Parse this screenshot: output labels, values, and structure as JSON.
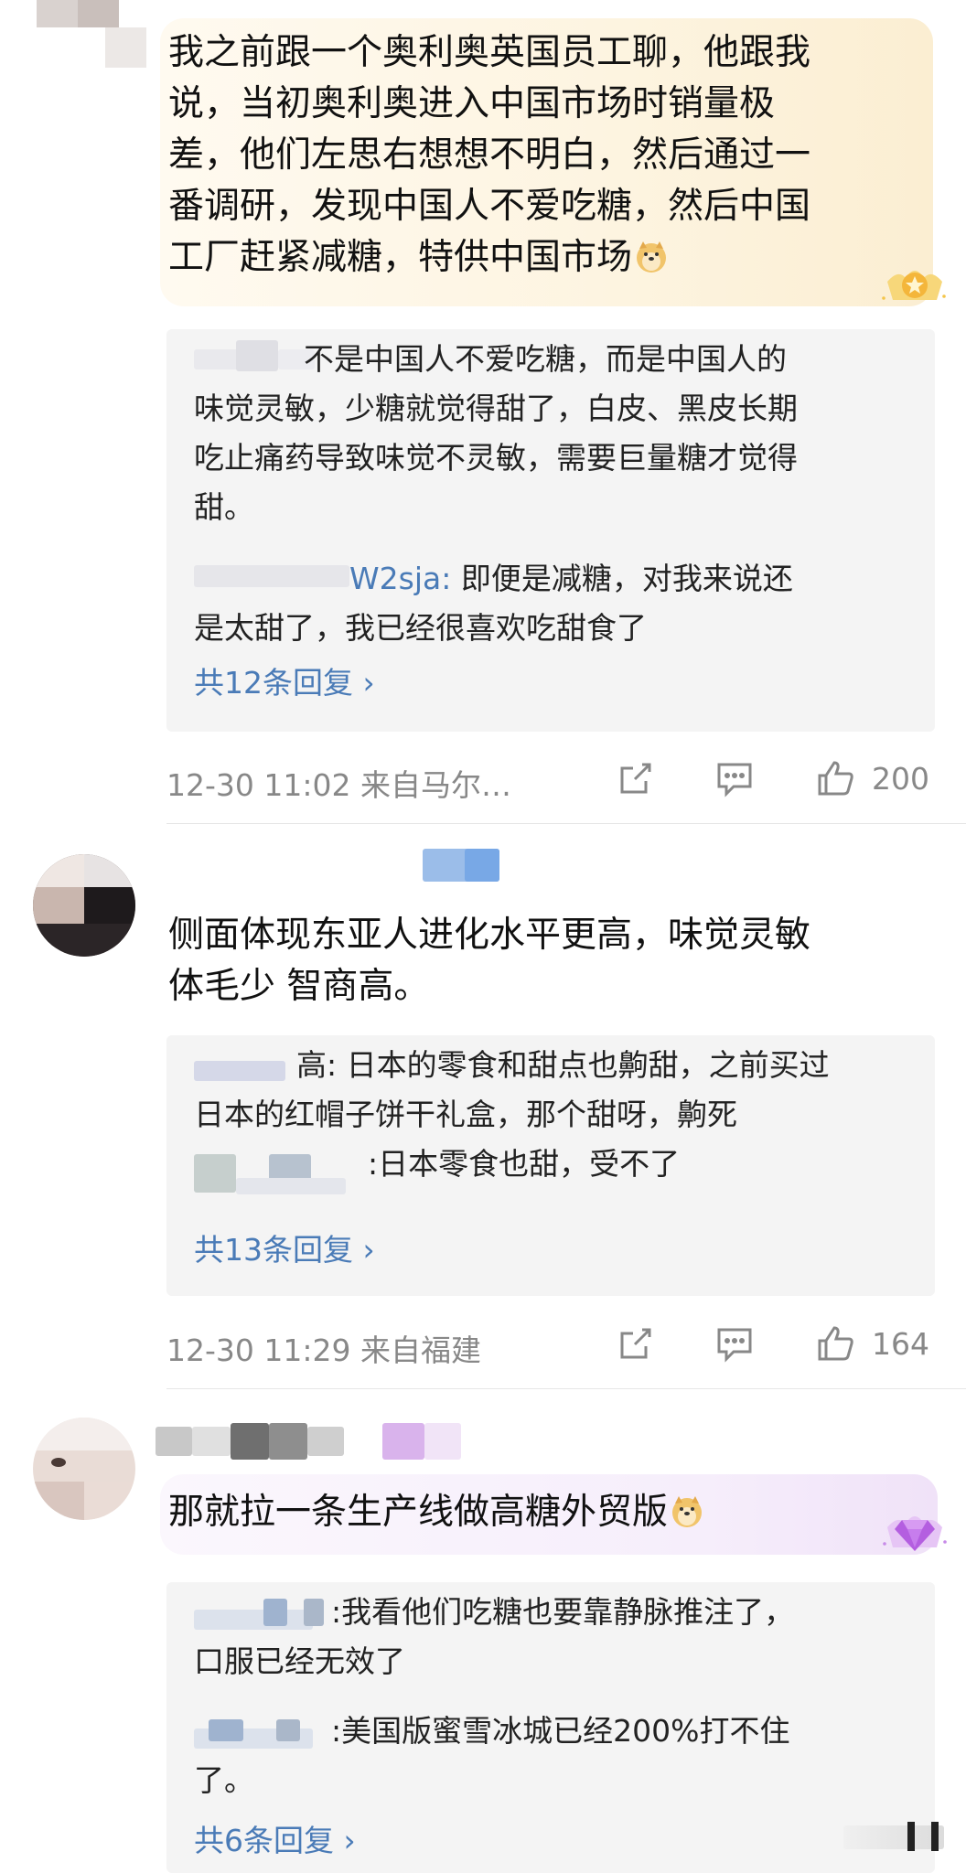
{
  "comments": [
    {
      "text_lines": [
        "我之前跟一个奥利奥英国员工聊，他跟我",
        "说，当初奥利奥进入中国市场时销量极",
        "差，他们左思右想想不明白，然后通过一",
        "番调研，发现中国人不爱吃糖，然后中国",
        "工厂赶紧减糖，特供中国市场"
      ],
      "emoji": "doge-emoji",
      "badge": "crown-star-badge",
      "replies": [
        {
          "lines": [
            "不是中国人不爱吃糖，而是中国人的",
            "味觉灵敏，少糖就觉得甜了，白皮、黑皮长期",
            "吃止痛药导致味觉不灵敏，需要巨量糖才觉得",
            "甜。"
          ]
        },
        {
          "name_fragment": "W2sja:",
          "lines": [
            "即便是减糖，对我来说还",
            "是太甜了，我已经很喜欢吃甜食了"
          ]
        }
      ],
      "reply_count": "共12条回复",
      "time": "12-30 11:02",
      "source": "来自马尔…",
      "likes": "200"
    },
    {
      "text_lines": [
        "侧面体现东亚人进化水平更高，味觉灵敏",
        "体毛少 智商高。"
      ],
      "replies": [
        {
          "name_fragment": "高:",
          "lines": [
            "日本的零食和甜点也齁甜，之前买过",
            "日本的红帽子饼干礼盒，那个甜呀，齁死"
          ]
        },
        {
          "name_fragment": ":",
          "lines": [
            "日本零食也甜，受不了"
          ]
        }
      ],
      "reply_count": "共13条回复",
      "time": "12-30 11:29",
      "source": "来自福建",
      "likes": "164"
    },
    {
      "text_lines": [
        "那就拉一条生产线做高糖外贸版"
      ],
      "emoji": "doge-emoji",
      "badge": "diamond-badge",
      "replies": [
        {
          "name_fragment": ":",
          "lines": [
            "我看他们吃糖也要靠静脉推注了，",
            "口服已经无效了"
          ]
        },
        {
          "name_fragment": ":",
          "lines": [
            "美国版蜜雪冰城已经200%打不住",
            "了。"
          ]
        }
      ],
      "reply_count": "共6条回复"
    }
  ],
  "colors": {
    "link": "#4a7bb7",
    "meta": "#888888",
    "reply_bg": "#f4f4f4",
    "gold_bubble": "#fdf6e4",
    "purple_bubble": "#f7eefb"
  }
}
